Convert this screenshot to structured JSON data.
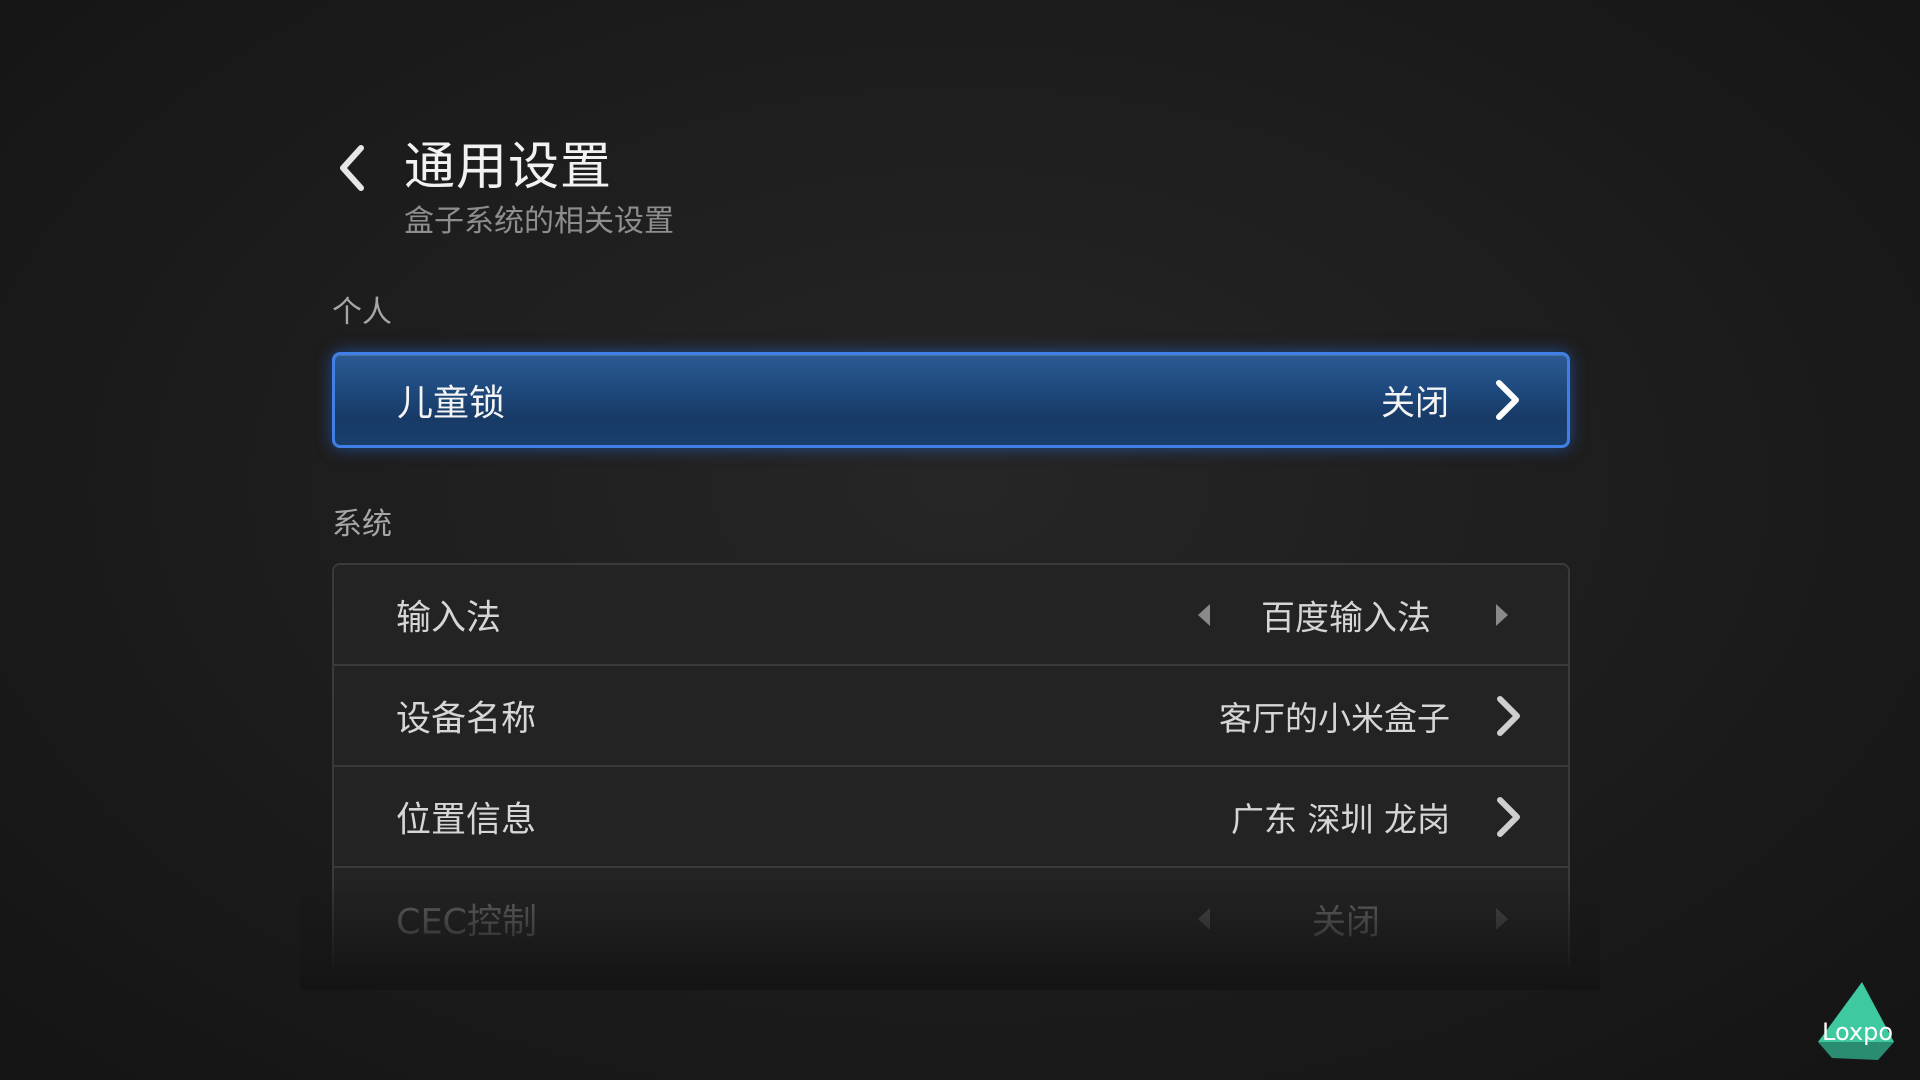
{
  "header": {
    "title": "通用设置",
    "subtitle": "盒子系统的相关设置"
  },
  "sections": {
    "personal": {
      "label": "个人",
      "items": [
        {
          "label": "儿童锁",
          "value": "关闭",
          "control": "chevron"
        }
      ]
    },
    "system": {
      "label": "系统",
      "items": [
        {
          "label": "输入法",
          "value": "百度输入法",
          "control": "arrows"
        },
        {
          "label": "设备名称",
          "value": "客厅的小米盒子",
          "control": "chevron"
        },
        {
          "label": "位置信息",
          "value": "广东 深圳 龙岗",
          "control": "chevron"
        },
        {
          "label": "CEC控制",
          "value": "关闭",
          "control": "arrows"
        }
      ]
    }
  },
  "watermark": {
    "text": "Loxpo"
  },
  "colors": {
    "focus_border": "#3f7fe6",
    "focus_fill": "#1f4b80",
    "background": "#1e1e1e"
  }
}
